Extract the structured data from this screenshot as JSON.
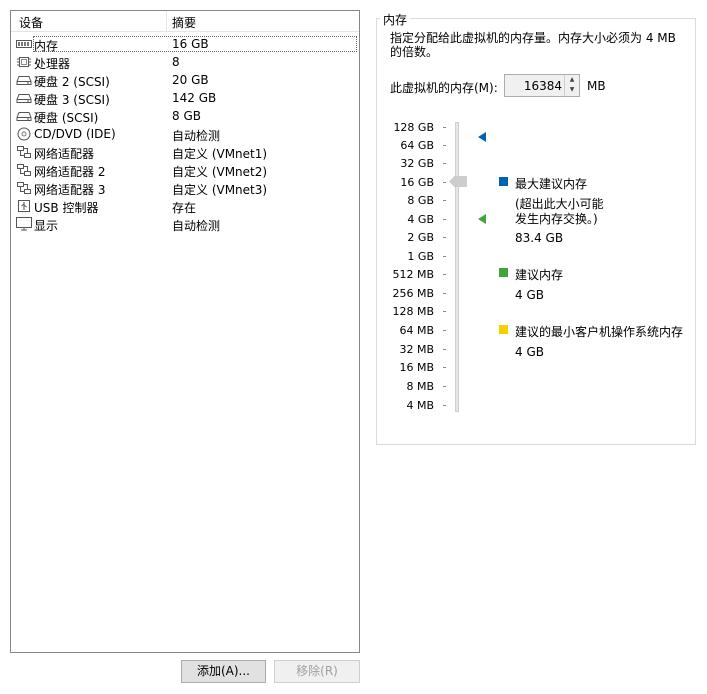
{
  "device_table": {
    "header_device": "设备",
    "header_summary": "摘要",
    "rows": [
      {
        "name": "内存",
        "summary": "16 GB",
        "icon": "memory-icon"
      },
      {
        "name": "处理器",
        "summary": "8",
        "icon": "processor-icon"
      },
      {
        "name": "硬盘 2 (SCSI)",
        "summary": "20 GB",
        "icon": "hard-disk-icon"
      },
      {
        "name": "硬盘 3 (SCSI)",
        "summary": "142 GB",
        "icon": "hard-disk-icon"
      },
      {
        "name": "硬盘 (SCSI)",
        "summary": "8 GB",
        "icon": "hard-disk-icon"
      },
      {
        "name": "CD/DVD (IDE)",
        "summary": "自动检测",
        "icon": "cd-dvd-icon"
      },
      {
        "name": "网络适配器",
        "summary": "自定义 (VMnet1)",
        "icon": "network-adapter-icon"
      },
      {
        "name": "网络适配器 2",
        "summary": "自定义 (VMnet2)",
        "icon": "network-adapter-icon"
      },
      {
        "name": "网络适配器 3",
        "summary": "自定义 (VMnet3)",
        "icon": "network-adapter-icon"
      },
      {
        "name": "USB 控制器",
        "summary": "存在",
        "icon": "usb-icon"
      },
      {
        "name": "显示",
        "summary": "自动检测",
        "icon": "display-icon"
      }
    ],
    "selected": "内存"
  },
  "buttons": {
    "add": "添加(A)...",
    "remove": "移除(R)"
  },
  "memory_panel": {
    "title": "内存",
    "description": "指定分配给此虚拟机的内存量。内存大小必须为 4 MB 的倍数。",
    "memory_label": "此虚拟机的内存(M):",
    "memory_value": "16384",
    "unit": "MB",
    "scale_labels": [
      "128 GB",
      "64 GB",
      "32 GB",
      "16 GB",
      "8 GB",
      "4 GB",
      "2 GB",
      "1 GB",
      "512 MB",
      "256 MB",
      "128 MB",
      "64 MB",
      "32 MB",
      "16 MB",
      "8 MB",
      "4 MB"
    ],
    "legend": {
      "max_recommended_title": "最大建议内存",
      "max_recommended_note_line1": "(超出此大小可能",
      "max_recommended_note_line2": "发生内存交换。)",
      "max_recommended_value": "83.4 GB",
      "recommended_title": "建议内存",
      "recommended_value": "4 GB",
      "min_guest_title": "建议的最小客户机操作系统内存",
      "min_guest_value": "4 GB"
    },
    "colors": {
      "max_recommended": "#0063b1",
      "recommended": "#3fa535",
      "min_guest": "#f6d000"
    }
  }
}
